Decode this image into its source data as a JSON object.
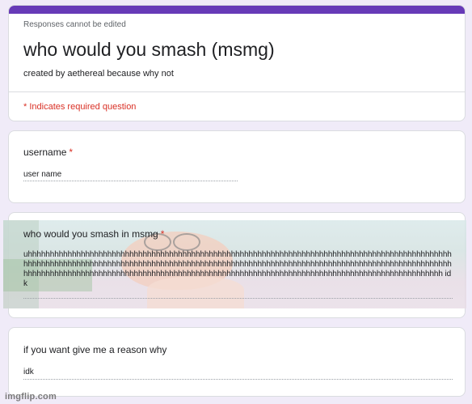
{
  "form": {
    "notice": "Responses cannot be edited",
    "title": "who would you smash (msmg)",
    "description": "created by aethereal because why not",
    "required_note": "* Indicates required question",
    "accent_color": "#673ab7"
  },
  "questions": [
    {
      "label": "username",
      "required_marker": "*",
      "answer": "user name"
    },
    {
      "label": "who would you smash in msmg",
      "required_marker": "*",
      "answer": "uhhhhhhhhhhhhhhhhhhhhhhhhhhhhhhhhhhhhhhhhhhhhhhhhhhhhhhhhhhhhhhhhhhhhhhhhhhhhhhhhhhhhhhhhhhhhhhhhhhhhhhhhhhhhhhhhhhhhhhhhhhhhhhhhhhhhhhhhhhhhhhhhhhhhhhhhhhhhhhhhhhhhhhhhhhhhhhhhhhhhhhhhhhhhhhhhhhhhhhhhhhhhhhhhhhhhhhhhhhhhhhhhhhhhhhhhhhhhhhhhhhhhhhhhhhhhhhhhhhhhhhhhhhhhhhhhhhhhhhhhhhhhhhhh idk"
    },
    {
      "label": "if you want give me a reason why",
      "required_marker": "",
      "answer": "idk"
    }
  ],
  "watermark": "imgflip.com"
}
